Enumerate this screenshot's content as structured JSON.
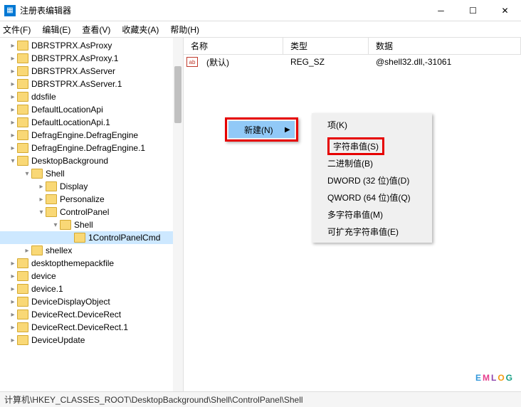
{
  "title": "注册表编辑器",
  "menu": {
    "file": "文件(F)",
    "edit": "编辑(E)",
    "view": "查看(V)",
    "fav": "收藏夹(A)",
    "help": "帮助(H)"
  },
  "columns": {
    "name": "名称",
    "type": "类型",
    "data": "数据"
  },
  "row": {
    "name": "(默认)",
    "type": "REG_SZ",
    "data": "@shell32.dll,-31061"
  },
  "tree": [
    {
      "indent": 0,
      "arrow": "▸",
      "label": "DBRSTPRX.AsProxy"
    },
    {
      "indent": 0,
      "arrow": "▸",
      "label": "DBRSTPRX.AsProxy.1"
    },
    {
      "indent": 0,
      "arrow": "▸",
      "label": "DBRSTPRX.AsServer"
    },
    {
      "indent": 0,
      "arrow": "▸",
      "label": "DBRSTPRX.AsServer.1"
    },
    {
      "indent": 0,
      "arrow": "▸",
      "label": "ddsfile"
    },
    {
      "indent": 0,
      "arrow": "▸",
      "label": "DefaultLocationApi"
    },
    {
      "indent": 0,
      "arrow": "▸",
      "label": "DefaultLocationApi.1"
    },
    {
      "indent": 0,
      "arrow": "▸",
      "label": "DefragEngine.DefragEngine"
    },
    {
      "indent": 0,
      "arrow": "▸",
      "label": "DefragEngine.DefragEngine.1"
    },
    {
      "indent": 0,
      "arrow": "▾",
      "label": "DesktopBackground"
    },
    {
      "indent": 1,
      "arrow": "▾",
      "label": "Shell"
    },
    {
      "indent": 2,
      "arrow": "▸",
      "label": "Display"
    },
    {
      "indent": 2,
      "arrow": "▸",
      "label": "Personalize"
    },
    {
      "indent": 2,
      "arrow": "▾",
      "label": "ControlPanel"
    },
    {
      "indent": 3,
      "arrow": "▾",
      "label": "Shell"
    },
    {
      "indent": 4,
      "arrow": "",
      "label": "1ControlPanelCmd",
      "selected": true
    },
    {
      "indent": 1,
      "arrow": "▸",
      "label": "shellex"
    },
    {
      "indent": 0,
      "arrow": "▸",
      "label": "desktopthemepackfile"
    },
    {
      "indent": 0,
      "arrow": "▸",
      "label": "device"
    },
    {
      "indent": 0,
      "arrow": "▸",
      "label": "device.1"
    },
    {
      "indent": 0,
      "arrow": "▸",
      "label": "DeviceDisplayObject"
    },
    {
      "indent": 0,
      "arrow": "▸",
      "label": "DeviceRect.DeviceRect"
    },
    {
      "indent": 0,
      "arrow": "▸",
      "label": "DeviceRect.DeviceRect.1"
    },
    {
      "indent": 0,
      "arrow": "▸",
      "label": "DeviceUpdate"
    }
  ],
  "ctx1": {
    "new": "新建(N)"
  },
  "ctx2": {
    "key": "项(K)",
    "string": "字符串值(S)",
    "binary": "二进制值(B)",
    "dword": "DWORD (32 位)值(D)",
    "qword": "QWORD (64 位)值(Q)",
    "multi": "多字符串值(M)",
    "expand": "可扩充字符串值(E)"
  },
  "status": "计算机\\HKEY_CLASSES_ROOT\\DesktopBackground\\Shell\\ControlPanel\\Shell",
  "watermark": "EMLOG"
}
